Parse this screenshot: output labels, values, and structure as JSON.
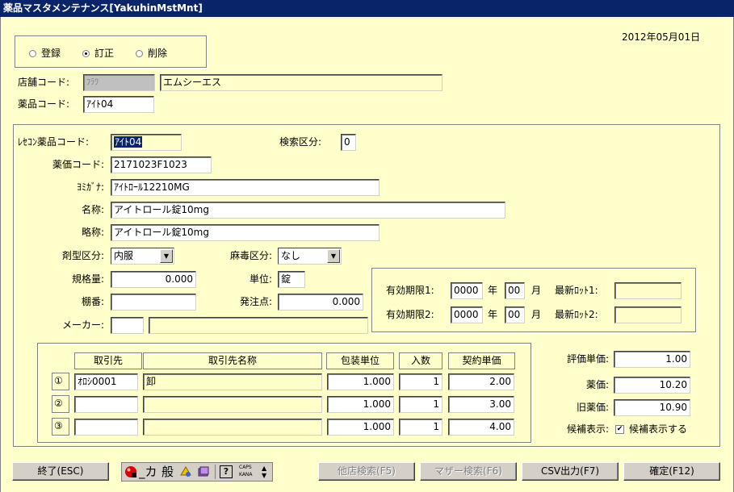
{
  "window": {
    "title": "薬品マスタメンテナンス[YakuhinMstMnt]"
  },
  "date": "2012年05月01日",
  "mode": {
    "options": [
      {
        "label": "登録",
        "selected": false
      },
      {
        "label": "訂正",
        "selected": true
      },
      {
        "label": "削除",
        "selected": false
      }
    ]
  },
  "store": {
    "label": "店舗コード:",
    "code": "ﾌﾗﾜ",
    "name": "エムシーエス"
  },
  "drug_code": {
    "label": "薬品コード:",
    "value": "ｱｲﾄ04"
  },
  "detail": {
    "rececon_code": {
      "label": "ﾚｾｺﾝ薬品コード:",
      "value": "ｱｲﾄ04"
    },
    "search_kubun": {
      "label": "検索区分:",
      "value": "0"
    },
    "yakka_code": {
      "label": "薬価コード:",
      "value": "2171023F1023"
    },
    "yomigana": {
      "label": "ﾖﾐｶﾞﾅ:",
      "value": "ｱｲﾄﾛｰﾙ12210MG"
    },
    "name": {
      "label": "名称:",
      "value": "アイトロール錠10mg"
    },
    "short_name": {
      "label": "略称:",
      "value": "アイトロール錠10mg"
    },
    "dosage_form": {
      "label": "剤型区分:",
      "value": "内服"
    },
    "narcotic": {
      "label": "麻毒区分:",
      "value": "なし"
    },
    "spec_qty": {
      "label": "規格量:",
      "value": "0.000"
    },
    "unit": {
      "label": "単位:",
      "value": "錠"
    },
    "shelf": {
      "label": "棚番:",
      "value": ""
    },
    "order_point": {
      "label": "発注点:",
      "value": "0.000"
    },
    "maker": {
      "label": "メーカー:",
      "code": "",
      "name": ""
    }
  },
  "expiry": {
    "rows": [
      {
        "label": "有効期限1:",
        "year": "0000",
        "year_unit": "年",
        "month": "00",
        "month_unit": "月",
        "lot_label": "最新ﾛｯﾄ1:",
        "lot": ""
      },
      {
        "label": "有効期限2:",
        "year": "0000",
        "year_unit": "年",
        "month": "00",
        "month_unit": "月",
        "lot_label": "最新ﾛｯﾄ2:",
        "lot": ""
      }
    ]
  },
  "suppliers": {
    "headers": [
      "取引先",
      "取引先名称",
      "包装単位",
      "入数",
      "契約単価"
    ],
    "rows": [
      {
        "no": "①",
        "code": "ｵﾛｼ0001",
        "name": "卸",
        "pack": "1.000",
        "qty": "1",
        "price": "2.00"
      },
      {
        "no": "②",
        "code": "",
        "name": "",
        "pack": "1.000",
        "qty": "1",
        "price": "3.00"
      },
      {
        "no": "③",
        "code": "",
        "name": "",
        "pack": "1.000",
        "qty": "1",
        "price": "4.00"
      }
    ]
  },
  "pricing": {
    "eval_price": {
      "label": "評価単価:",
      "value": "1.00"
    },
    "yakka": {
      "label": "薬価:",
      "value": "10.20"
    },
    "old_yakka": {
      "label": "旧薬価:",
      "value": "10.90"
    },
    "candidate": {
      "label": "候補表示:",
      "check_label": "候補表示する",
      "checked": true
    }
  },
  "footer": {
    "exit": "終了(ESC)",
    "ime": {
      "general": "般",
      "caps": "CAPS",
      "kana": "KANA"
    },
    "other_store": "他店検索(F5)",
    "master_search": "マザー検索(F6)",
    "csv": "CSV出力(F7)",
    "confirm": "確定(F12)"
  }
}
